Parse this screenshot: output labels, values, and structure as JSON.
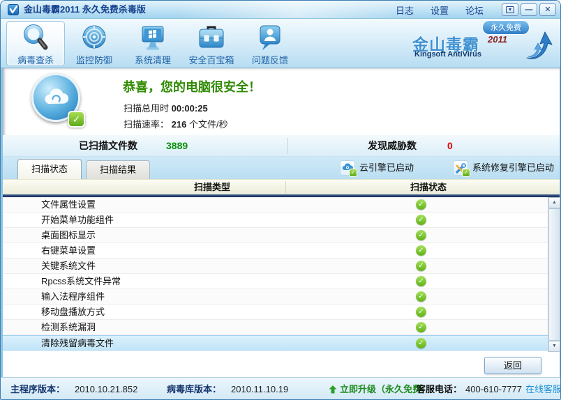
{
  "colors": {
    "accent_blue": "#2f86c8",
    "success_green": "#2f8a00",
    "danger_red": "#e60000",
    "link_blue": "#1e90d6",
    "titlebar_text": "#15418e"
  },
  "window": {
    "title": "金山毒霸2011 永久免费杀毒版",
    "menu": [
      {
        "label": "日志"
      },
      {
        "label": "设置"
      },
      {
        "label": "论坛"
      }
    ],
    "controls": {
      "skin_glyph": "▾",
      "minimize_glyph": "—",
      "close_glyph": "✕"
    }
  },
  "toolbar": {
    "items": [
      {
        "label": "病毒查杀",
        "icon": "magnifier-icon",
        "active": true
      },
      {
        "label": "监控防御",
        "icon": "radar-icon",
        "active": false
      },
      {
        "label": "系统清理",
        "icon": "system-clean-icon",
        "active": false
      },
      {
        "label": "安全百宝箱",
        "icon": "toolbox-icon",
        "active": false
      },
      {
        "label": "问题反馈",
        "icon": "feedback-icon",
        "active": false
      }
    ],
    "brand": {
      "badge": "永久免费",
      "name": "金山毒霸",
      "year": "2011",
      "subtitle": "Kingsoft AntiVirus"
    }
  },
  "result": {
    "headline": "恭喜，您的电脑很安全！",
    "time_label": "扫描总用时",
    "time_value": "00:00:25",
    "rate_label": "扫描速率：",
    "rate_value": "216",
    "rate_unit": "个文件/秒"
  },
  "stats": {
    "scanned_label": "已扫描文件数",
    "scanned_value": "3889",
    "threats_label": "发现威胁数",
    "threats_value": "0"
  },
  "tabs": [
    {
      "label": "扫描状态",
      "active": true
    },
    {
      "label": "扫描结果",
      "active": false
    }
  ],
  "engines": [
    {
      "label": "云引擎已启动",
      "icon": "cloud-engine-icon"
    },
    {
      "label": "系统修复引擎已启动",
      "icon": "repair-engine-icon"
    }
  ],
  "table": {
    "columns": [
      "扫描类型",
      "扫描状态"
    ],
    "check_glyph": "✓",
    "rows": [
      {
        "label": "文件属性设置",
        "status": "ok",
        "selected": false
      },
      {
        "label": "开始菜单功能组件",
        "status": "ok",
        "selected": false
      },
      {
        "label": "桌面图标显示",
        "status": "ok",
        "selected": false
      },
      {
        "label": "右键菜单设置",
        "status": "ok",
        "selected": false
      },
      {
        "label": "关键系统文件",
        "status": "ok",
        "selected": false
      },
      {
        "label": "Rpcss系统文件异常",
        "status": "ok",
        "selected": false
      },
      {
        "label": "输入法程序组件",
        "status": "ok",
        "selected": false
      },
      {
        "label": "移动盘播放方式",
        "status": "ok",
        "selected": false
      },
      {
        "label": "检测系统漏洞",
        "status": "ok",
        "selected": false
      },
      {
        "label": "清除残留病毒文件",
        "status": "ok",
        "selected": true
      }
    ]
  },
  "scrollbar": {
    "up_glyph": "▲",
    "down_glyph": "▼"
  },
  "footer": {
    "back_label": "返回"
  },
  "statusbar": {
    "app_version_label": "主程序版本：",
    "app_version": "2010.10.21.852",
    "db_version_label": "病毒库版本：",
    "db_version": "2010.11.10.19",
    "upgrade_label": "立即升级（永久免费）",
    "phone_label": "客服电话：",
    "phone": "400-610-7777",
    "online_service": "在线客服"
  }
}
